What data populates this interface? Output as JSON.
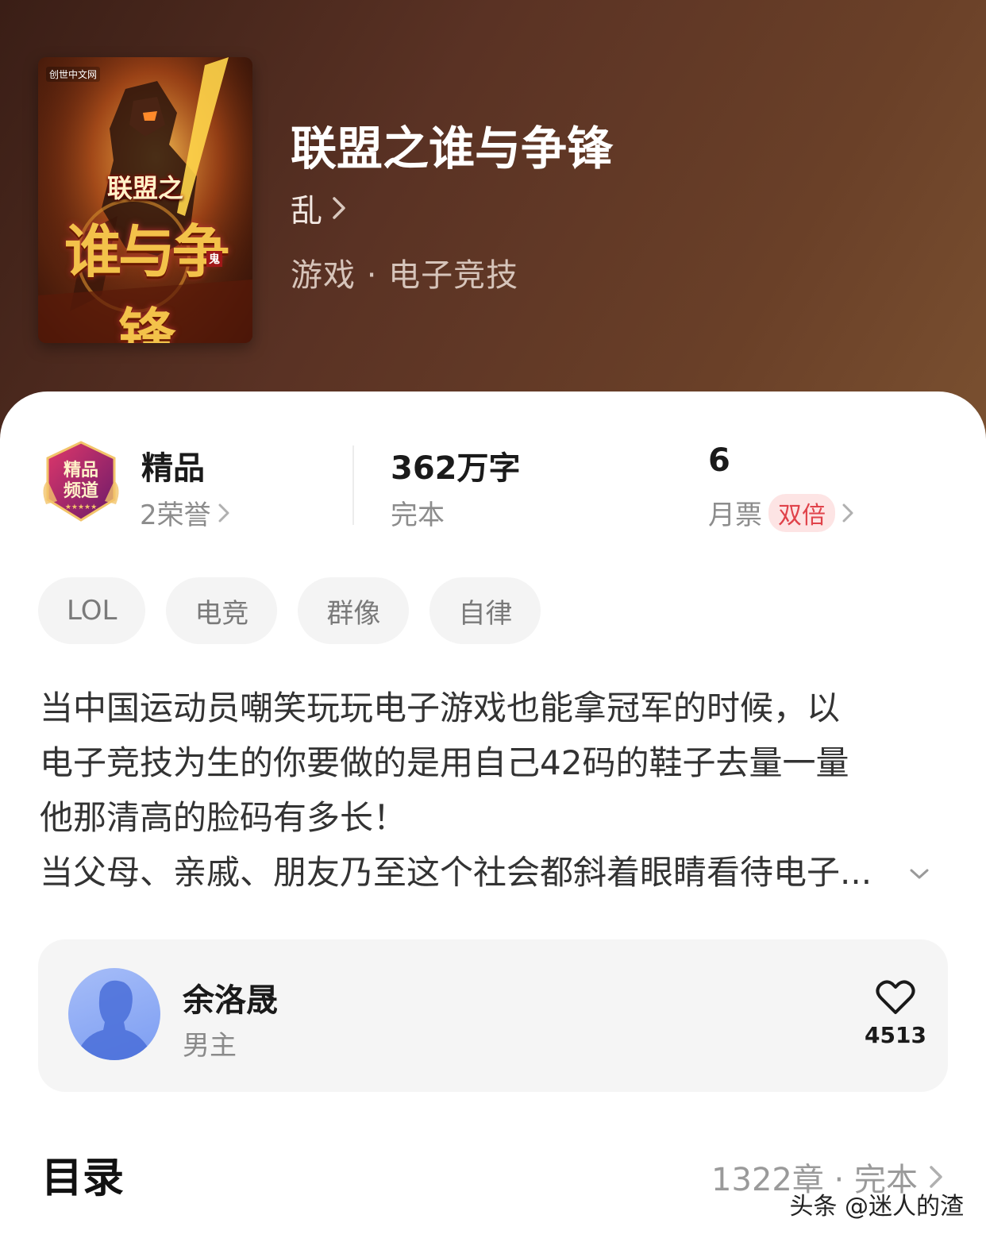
{
  "book": {
    "title": "联盟之谁与争锋",
    "author": "乱",
    "genre": "游戏 · 电子竞技",
    "cover": {
      "publisher_badge": "创世中文网",
      "line1": "联盟之",
      "line2": "谁与争锋",
      "author_mark": "鬼"
    }
  },
  "stats": {
    "quality": {
      "title": "精品",
      "honor": "2荣誉",
      "badge_text": "精品频道"
    },
    "words": {
      "title": "362万字",
      "status": "完本"
    },
    "tickets": {
      "title": "6",
      "label": "月票",
      "badge": "双倍"
    }
  },
  "tags": [
    "LOL",
    "电竞",
    "群像",
    "自律"
  ],
  "description": [
    "当中国运动员嘲笑玩玩电子游戏也能拿冠军的时候，以",
    "电子竞技为生的你要做的是用自己42码的鞋子去量一量",
    "他那清高的脸码有多长！",
    "当父母、亲戚、朋友乃至这个社会都斜着眼睛看待电子..."
  ],
  "character": {
    "name": "余洛晟",
    "role": "男主",
    "likes": "4513"
  },
  "toc": {
    "title": "目录",
    "info": "1322章 · 完本"
  },
  "watermark": "头条 @迷人的渣",
  "colors": {
    "accent_red": "#e0424a",
    "header_brown": "#5a3224"
  }
}
